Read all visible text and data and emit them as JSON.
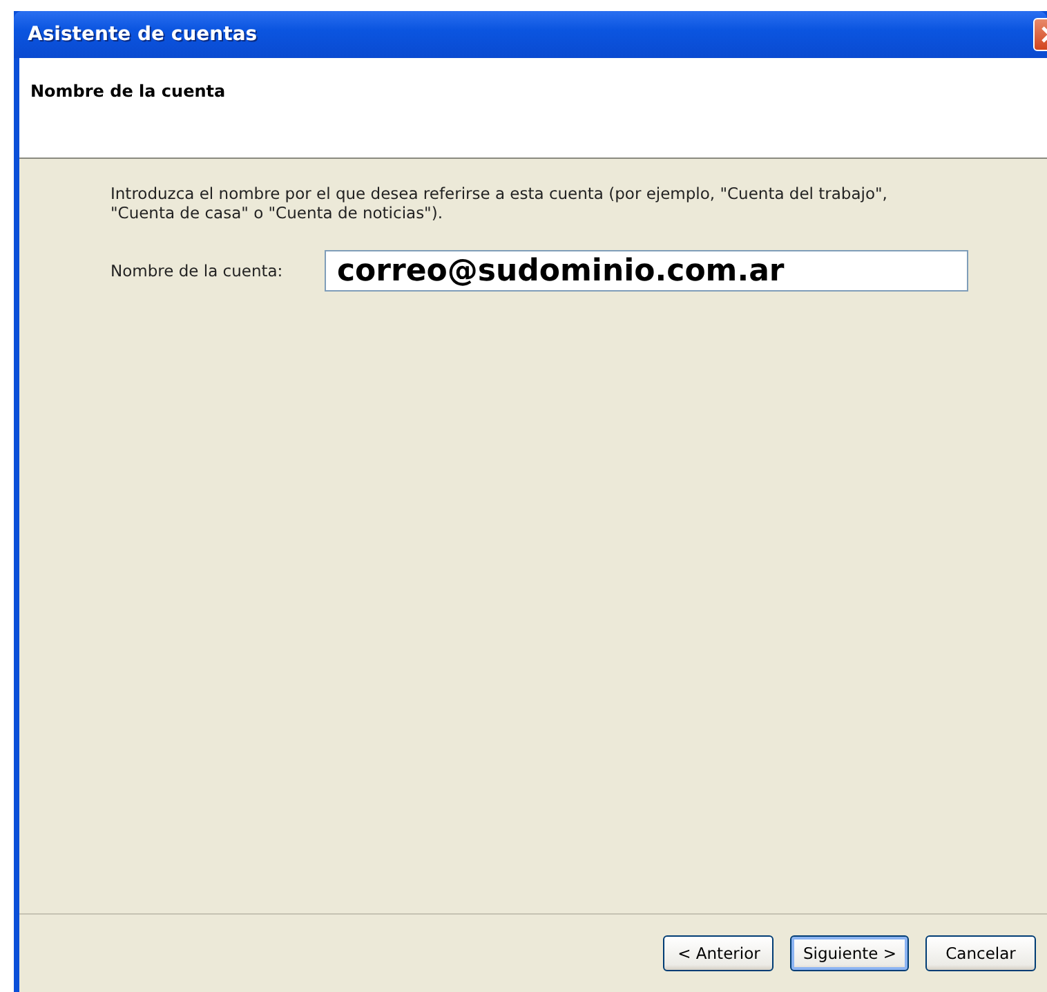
{
  "window": {
    "title": "Asistente de cuentas"
  },
  "header": {
    "title": "Nombre de la cuenta"
  },
  "description": "Introduzca el nombre por el que desea referirse a esta cuenta (por ejemplo, \"Cuenta del trabajo\", \"Cuenta de casa\" o \"Cuenta de noticias\").",
  "account_name": {
    "label": "Nombre de la cuenta:",
    "value": "correo@sudominio.com.ar"
  },
  "buttons": [
    {
      "label": "< Anterior",
      "default": false
    },
    {
      "label": "Siguiente >",
      "default": true
    },
    {
      "label": "Cancelar",
      "default": false
    }
  ]
}
